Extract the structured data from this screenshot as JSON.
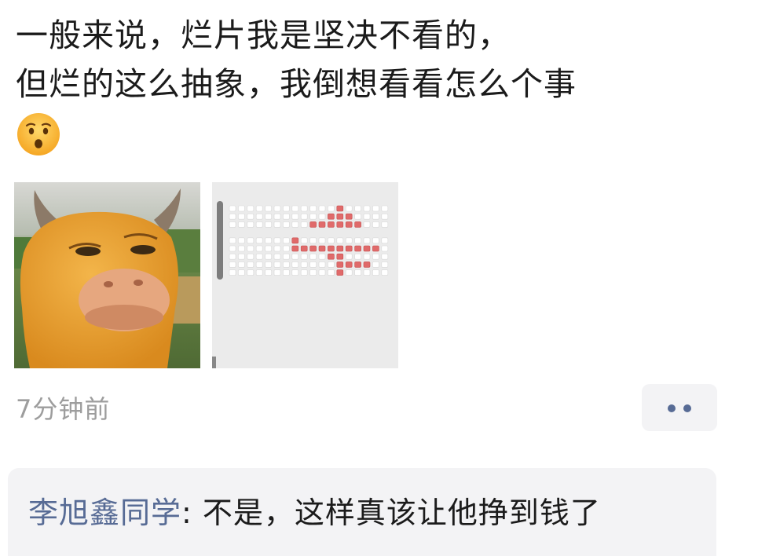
{
  "post": {
    "lines": [
      "一般来说，烂片我是坚决不看的，",
      "但烂的这么抽象，我倒想看看怎么个事"
    ],
    "emoji_icon": "hushed-face-emoji",
    "images": [
      {
        "icon": "cartoon-bull-face-image"
      },
      {
        "icon": "cinema-seat-map-screenshot"
      }
    ],
    "timestamp": "7分钟前",
    "more_button_icon": "two-dots-icon"
  },
  "comment": {
    "author": "李旭鑫同学",
    "separator": ": ",
    "text": "不是，这样真该让他挣到钱了"
  },
  "colors": {
    "text": "#1b1b1b",
    "link": "#576b95",
    "muted": "#9d9d9d",
    "panel": "#f3f3f5",
    "seat": "#ffffff",
    "seat_sold": "#e06a6a"
  }
}
